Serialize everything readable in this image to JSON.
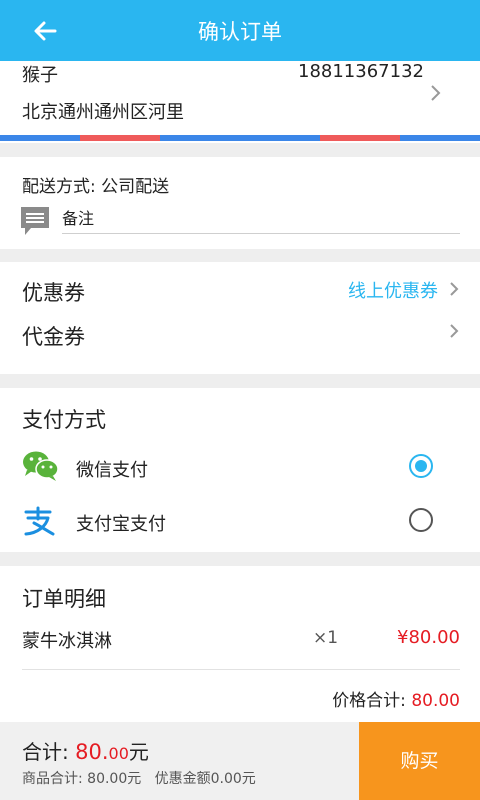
{
  "header": {
    "title": "确认订单",
    "back_icon": "arrow-left-icon"
  },
  "address": {
    "name": "猴子",
    "phone": "18811367132",
    "detail": "北京通州通州区河里",
    "stripe_colors": [
      "#3b86e8",
      "#ef5a5a",
      "#3b86e8",
      "#3b86e8",
      "#ef5a5a",
      "#3b86e8"
    ]
  },
  "delivery": {
    "method": "配送方式: 公司配送",
    "note_placeholder": "备注"
  },
  "coupons": {
    "coupon_label": "优惠券",
    "coupon_value": "线上优惠券",
    "voucher_label": "代金券"
  },
  "payment": {
    "title": "支付方式",
    "options": [
      {
        "label": "微信支付",
        "icon": "wechat-pay-icon",
        "selected": true
      },
      {
        "label": "支付宝支付",
        "icon": "alipay-icon",
        "selected": false
      }
    ]
  },
  "order": {
    "title": "订单明细",
    "items": [
      {
        "name": "蒙牛冰淇淋",
        "qty": "×1",
        "price": "¥80.00"
      }
    ],
    "total_label": "价格合计: ",
    "total_value": "80.00"
  },
  "footer": {
    "sum_label": "合计: ",
    "sum_int": "80.",
    "sum_dec": "00",
    "sum_unit": "元",
    "goods_total": "商品合计: 80.00元",
    "discount": "优惠金额0.00元",
    "buy_label": "购买"
  },
  "colors": {
    "accent": "#2ab6f0",
    "price": "#e51c23",
    "buy": "#f7951d"
  }
}
